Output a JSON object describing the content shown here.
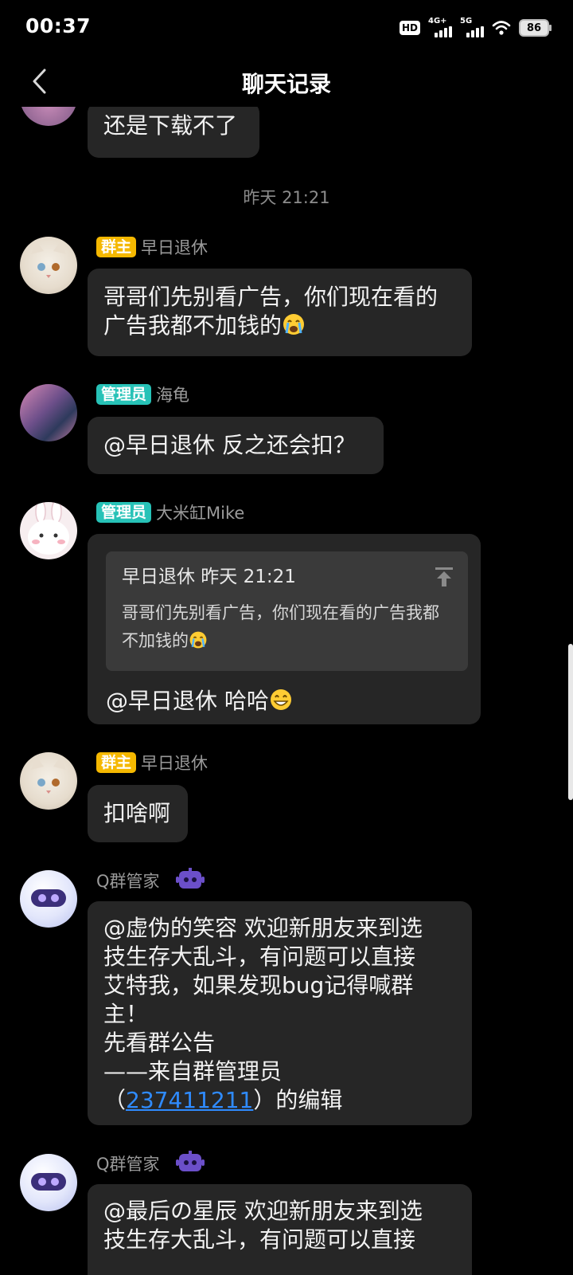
{
  "status_bar": {
    "time": "00:37",
    "hd_label": "HD",
    "network_1": "4G+",
    "network_2": "5G",
    "battery": "86"
  },
  "header": {
    "title": "聊天记录"
  },
  "messages": [
    {
      "text": "还是下载不了"
    },
    {
      "timestamp": "昨天 21:21"
    },
    {
      "role": "群主",
      "sender": "早日退休",
      "text": "哥哥们先别看广告，你们现在看的广告我都不加钱的"
    },
    {
      "role": "管理员",
      "sender": "海龟",
      "text": "@早日退休 反之还会扣？"
    },
    {
      "role": "管理员",
      "sender": "大米缸Mike",
      "quote_head": "早日退休  昨天 21:21",
      "quote_text": "哥哥们先别看广告，你们现在看的广告我都不加钱的",
      "text": "@早日退休 哈哈"
    },
    {
      "role": "群主",
      "sender": "早日退休",
      "text": "扣啥啊"
    },
    {
      "sender": "Q群管家",
      "lines": [
        "@虚伪的笑容 欢迎新朋友来到选",
        "技生存大乱斗，有问题可以直接",
        "艾特我，如果发现bug记得喊群",
        "主！",
        "先看群公告",
        "——来自群管理员"
      ],
      "edit_prefix": "（",
      "edit_link": "237411211",
      "edit_suffix": "）的编辑"
    },
    {
      "sender": "Q群管家",
      "lines": [
        "@最后の星辰 欢迎新朋友来到选",
        "技生存大乱斗，有问题可以直接"
      ]
    }
  ],
  "colors": {
    "owner_badge": "#f5b800",
    "admin_badge": "#27c2b7",
    "bubble": "#262626",
    "link": "#2f8bff"
  }
}
